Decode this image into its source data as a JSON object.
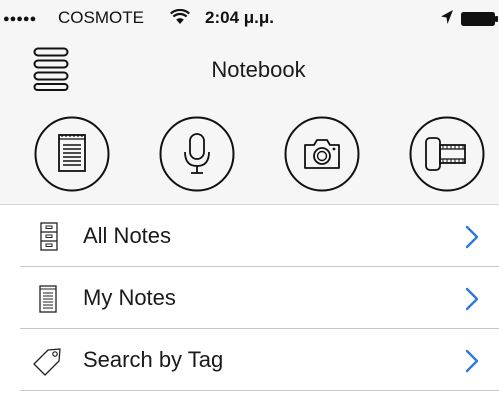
{
  "status_bar": {
    "signal": "●●●●●",
    "carrier": "COSMOTE",
    "time": "2:04 μ.μ."
  },
  "nav": {
    "title": "Notebook",
    "menu_icon": "hamburger-menu-icon"
  },
  "actions": [
    {
      "icon": "notepad-icon"
    },
    {
      "icon": "microphone-icon"
    },
    {
      "icon": "camera-icon"
    },
    {
      "icon": "film-roll-icon"
    }
  ],
  "list": [
    {
      "label": "All Notes",
      "icon": "file-cabinet-icon"
    },
    {
      "label": "My Notes",
      "icon": "notepad-icon"
    },
    {
      "label": "Search by Tag",
      "icon": "tag-icon"
    }
  ],
  "colors": {
    "accent": "#2f7ad8",
    "header_bg": "#f6f6f7",
    "separator": "#c8c8cc"
  }
}
